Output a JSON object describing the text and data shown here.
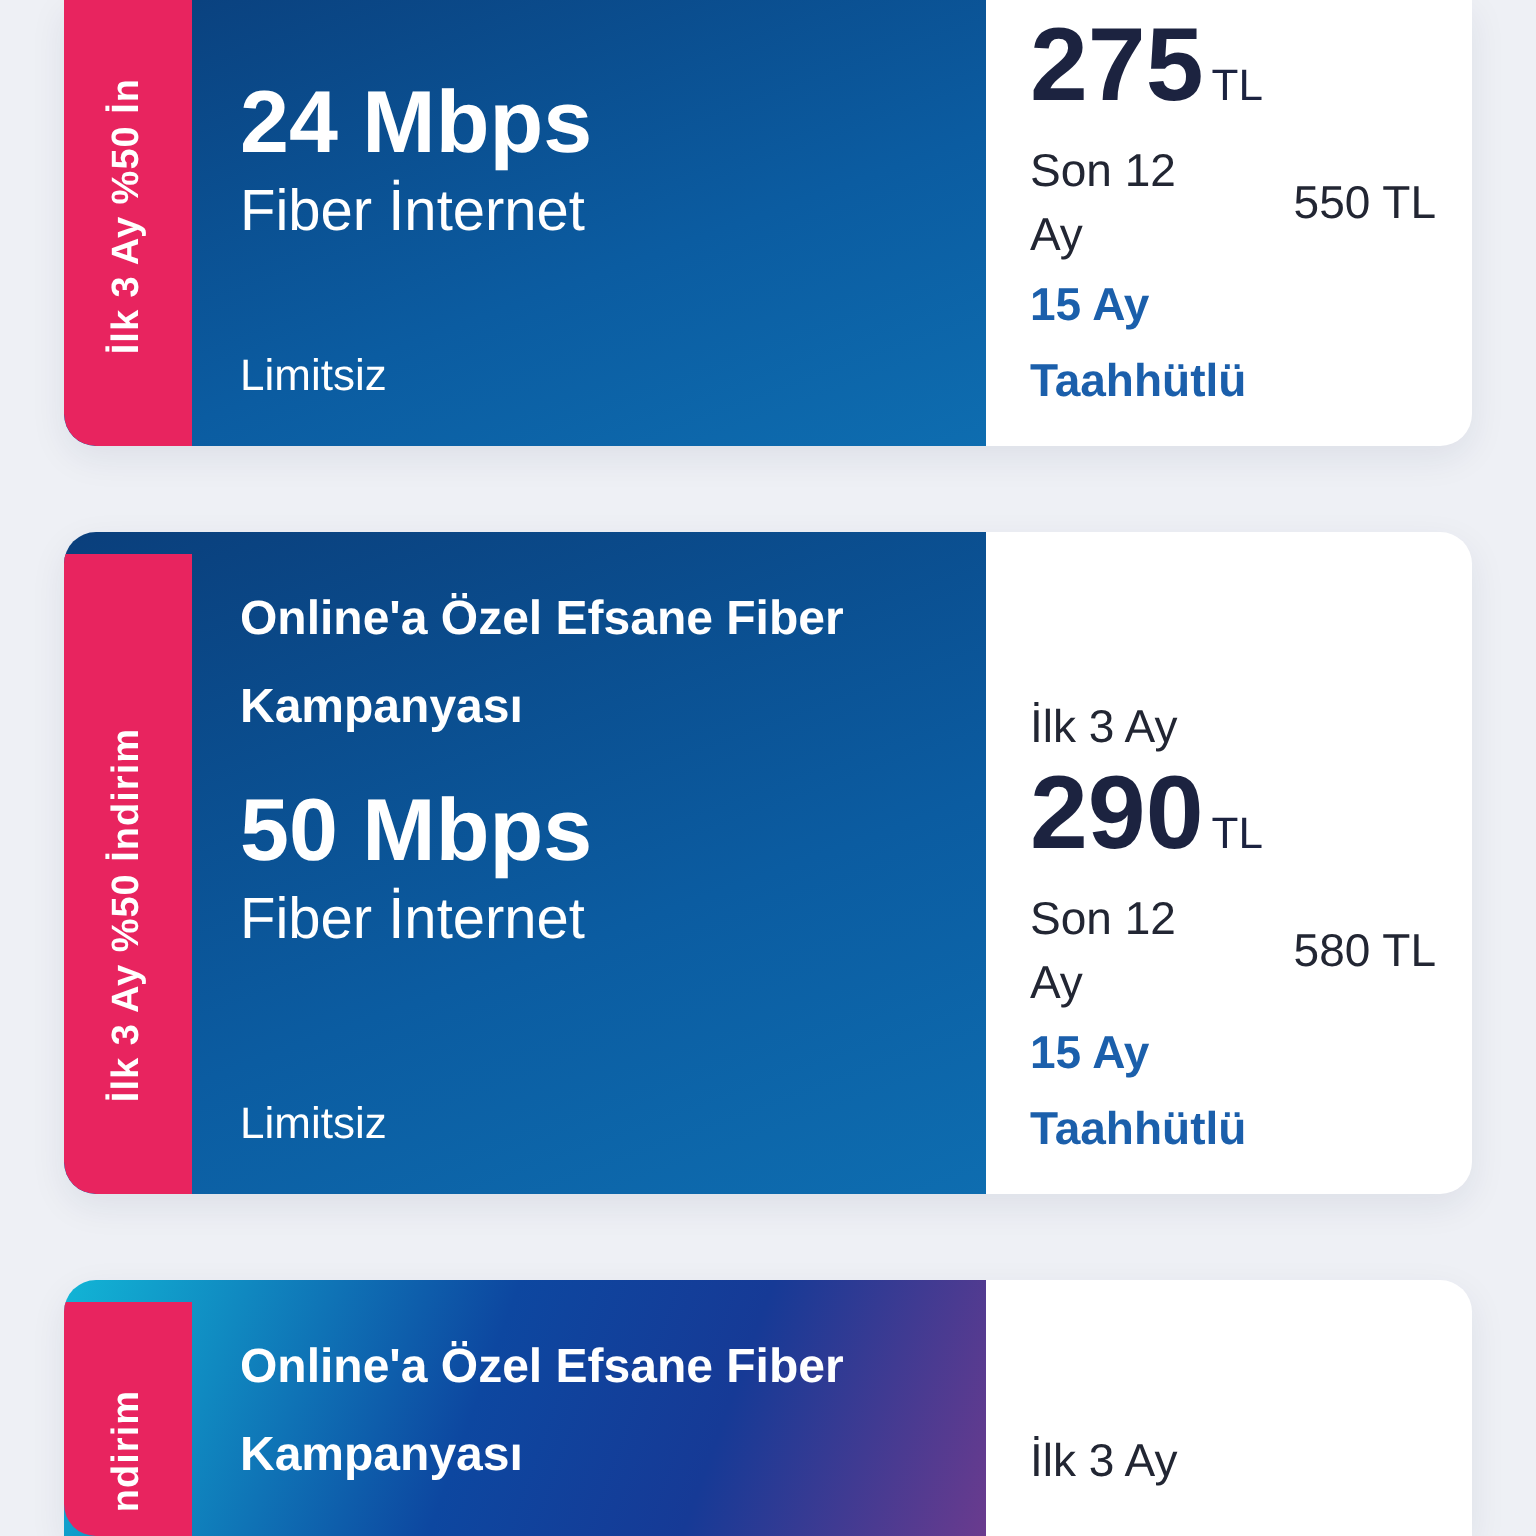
{
  "plans": [
    {
      "kind": "standard",
      "badge": "İlk 3 Ay %50 İn",
      "speed": "24 Mbps",
      "type": "Fiber İnternet",
      "quota": "Limitsiz",
      "price": "275",
      "currency": "TL",
      "later_label": "Son 12 Ay",
      "later_price": "550 TL",
      "commitment": "15 Ay Taahhütlü"
    },
    {
      "kind": "standard",
      "badge": "İlk 3 Ay %50 İndirim",
      "title": "Online'a Özel Efsane Fiber Kampanyası",
      "speed": "50 Mbps",
      "type": "Fiber İnternet",
      "quota": "Limitsiz",
      "promo_label": "İlk 3 Ay",
      "price": "290",
      "currency": "TL",
      "later_label": "Son 12 Ay",
      "later_price": "580 TL",
      "commitment": "15 Ay Taahhütlü"
    },
    {
      "kind": "bright",
      "badge": "ndirim",
      "title": "Online'a Özel Efsane Fiber Kampanyası",
      "promo_label": "İlk 3 Ay"
    }
  ]
}
